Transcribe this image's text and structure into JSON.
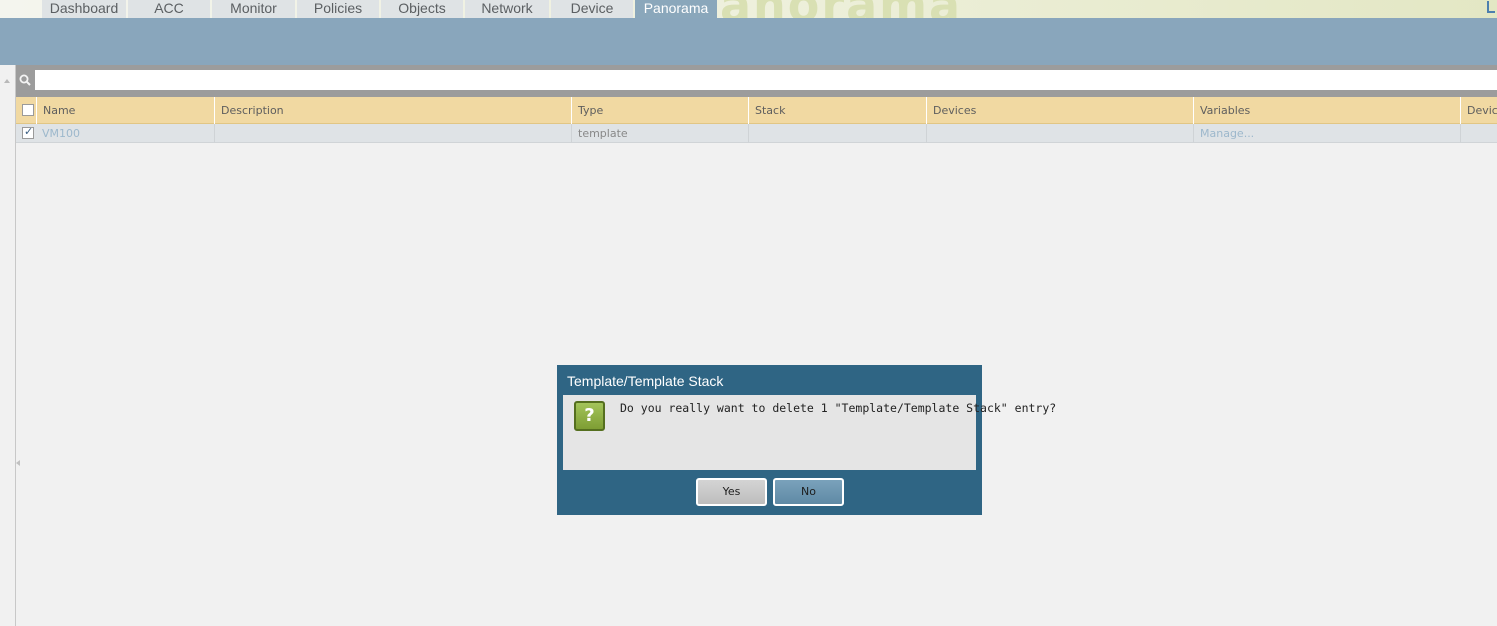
{
  "app": {
    "watermark": "anorama"
  },
  "nav": {
    "tabs": [
      {
        "label": "Dashboard",
        "active": false
      },
      {
        "label": "ACC",
        "active": false
      },
      {
        "label": "Monitor",
        "active": false
      },
      {
        "label": "Policies",
        "active": false
      },
      {
        "label": "Objects",
        "active": false
      },
      {
        "label": "Network",
        "active": false
      },
      {
        "label": "Device",
        "active": false
      },
      {
        "label": "Panorama",
        "active": true
      }
    ]
  },
  "search": {
    "value": "",
    "placeholder": ""
  },
  "table": {
    "columns": [
      "Name",
      "Description",
      "Type",
      "Stack",
      "Devices",
      "Variables",
      "Device"
    ],
    "rows": [
      {
        "selected": true,
        "cells": [
          "VM100",
          "",
          "template",
          "",
          "",
          "Manage...",
          ""
        ]
      }
    ]
  },
  "dialog": {
    "title": "Template/Template Stack",
    "icon": "question-icon",
    "icon_glyph": "?",
    "message": "Do you really want to delete 1 \"Template/Template Stack\" entry?",
    "yes_label": "Yes",
    "no_label": "No"
  },
  "colors": {
    "active_tab": "#8aa7bb",
    "header_band": "#89a6bc",
    "grid_header": "#f1d9a2",
    "dialog": "#2f6584"
  }
}
